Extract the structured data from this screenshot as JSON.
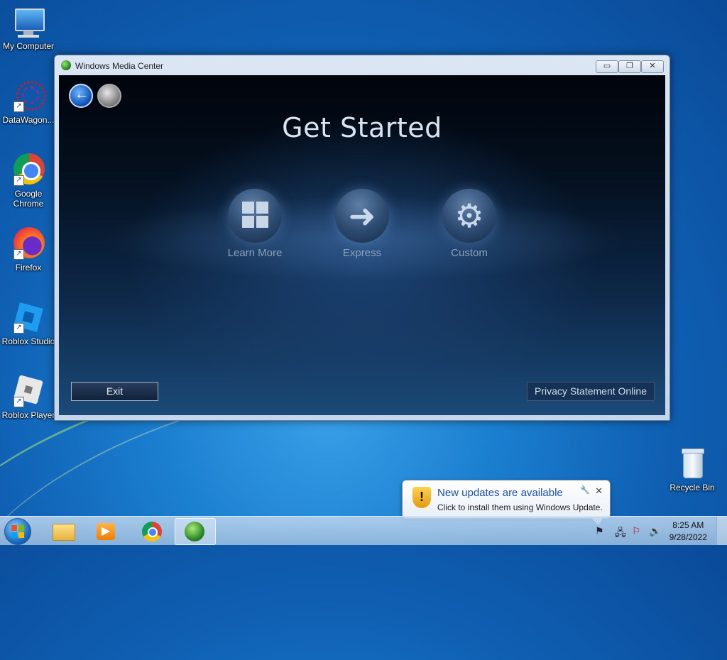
{
  "desktop": {
    "icons": [
      {
        "label": "My Computer",
        "icon": "computer-icon"
      },
      {
        "label": "DataWagon...",
        "icon": "datawagon-icon"
      },
      {
        "label": "Google Chrome",
        "icon": "chrome-icon"
      },
      {
        "label": "Firefox",
        "icon": "firefox-icon"
      },
      {
        "label": "Roblox Studio",
        "icon": "roblox-studio-icon"
      },
      {
        "label": "Roblox Player",
        "icon": "roblox-player-icon"
      },
      {
        "label": "Recycle Bin",
        "icon": "recycle-bin-icon"
      }
    ]
  },
  "window": {
    "title": "Windows Media Center",
    "controls": {
      "minimize": "▭",
      "restore": "❐",
      "close": "✕"
    },
    "heading": "Get Started",
    "options": [
      {
        "label": "Learn More",
        "icon": "windows-flag-icon"
      },
      {
        "label": "Express",
        "icon": "arrow-right-icon"
      },
      {
        "label": "Custom",
        "icon": "gears-icon"
      }
    ],
    "exit_label": "Exit",
    "privacy_label": "Privacy Statement Online"
  },
  "notification": {
    "title": "New updates are available",
    "text": "Click to install them using Windows Update.",
    "icon": "shield-warning-icon"
  },
  "taskbar": {
    "items": [
      {
        "name": "file-explorer",
        "icon": "folder-icon"
      },
      {
        "name": "media-player",
        "icon": "media-player-icon"
      },
      {
        "name": "chrome",
        "icon": "chrome-icon"
      },
      {
        "name": "media-center",
        "icon": "media-center-icon",
        "active": true
      }
    ],
    "time": "8:25 AM",
    "date": "9/28/2022"
  }
}
